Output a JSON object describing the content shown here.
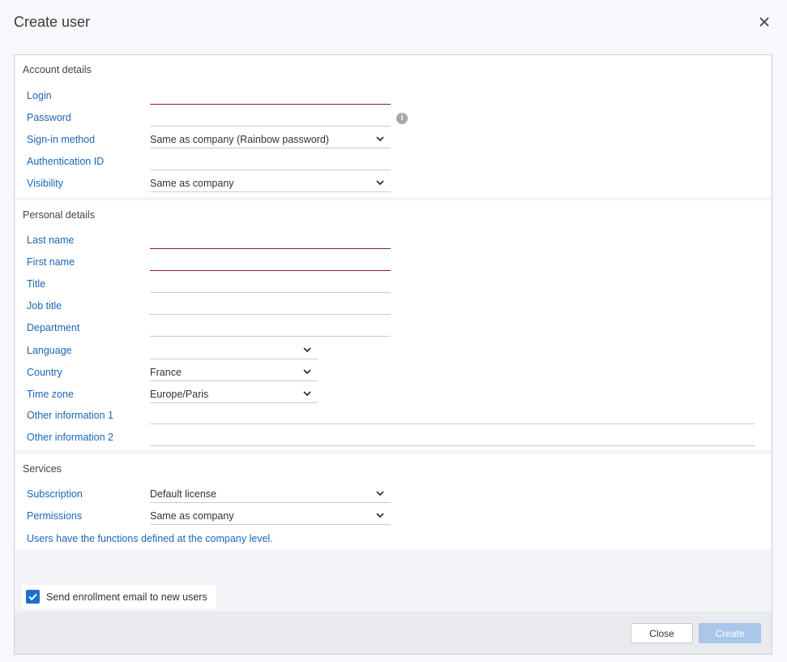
{
  "dialog": {
    "title": "Create user",
    "close_icon": "close-icon"
  },
  "account": {
    "title": "Account details",
    "login": {
      "label": "Login",
      "value": ""
    },
    "password": {
      "label": "Password",
      "value": "",
      "info_icon": "info-icon"
    },
    "sign_in": {
      "label": "Sign-in method",
      "value": "Same as company (Rainbow password)"
    },
    "auth_id": {
      "label": "Authentication ID",
      "value": ""
    },
    "visibility": {
      "label": "Visibility",
      "value": "Same as company"
    }
  },
  "personal": {
    "title": "Personal details",
    "last_name": {
      "label": "Last name",
      "value": ""
    },
    "first_name": {
      "label": "First name",
      "value": ""
    },
    "title_field": {
      "label": "Title",
      "value": ""
    },
    "job_title": {
      "label": "Job title",
      "value": ""
    },
    "department": {
      "label": "Department",
      "value": ""
    },
    "language": {
      "label": "Language",
      "value": ""
    },
    "country": {
      "label": "Country",
      "value": "France"
    },
    "time_zone": {
      "label": "Time zone",
      "value": "Europe/Paris"
    },
    "other1": {
      "label": "Other information 1",
      "value": ""
    },
    "other2": {
      "label": "Other information 2",
      "value": ""
    }
  },
  "services": {
    "title": "Services",
    "subscription": {
      "label": "Subscription",
      "value": "Default license"
    },
    "permissions": {
      "label": "Permissions",
      "value": "Same as company"
    },
    "note": "Users have the functions defined at the company level."
  },
  "enrollment": {
    "label": "Send enrollment email to new users",
    "checked": true
  },
  "footer": {
    "close_label": "Close",
    "create_label": "Create"
  },
  "colors": {
    "label_blue": "#1b67b7",
    "required_underline": "#8a1a4d",
    "checkbox_blue": "#1f6fd1",
    "create_disabled": "#aac6eb"
  }
}
